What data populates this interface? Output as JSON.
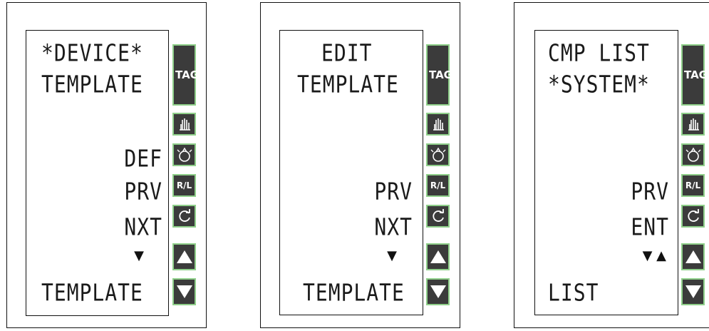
{
  "panels": [
    {
      "title_line1": "*DEVICE*",
      "title_line2": "TEMPLATE",
      "softkeys": [
        "DEF",
        "PRV",
        "NXT"
      ],
      "nav_arrows": "▼",
      "footer": "TEMPLATE"
    },
    {
      "title_line1": "EDIT",
      "title_line2": "TEMPLATE",
      "softkeys": [
        "PRV",
        "NXT"
      ],
      "nav_arrows": "▼",
      "footer": "TEMPLATE"
    },
    {
      "title_line1": "CMP LIST",
      "title_line2": "*SYSTEM*",
      "softkeys": [
        "PRV",
        "ENT"
      ],
      "nav_arrows": "▼ ▲",
      "footer": "LIST"
    }
  ],
  "keypad": {
    "tag_label": "TAG",
    "rl_label": "R/L",
    "key_icons": [
      "tag-key",
      "hand-icon",
      "actuator-icon",
      "rl-key",
      "refresh-icon",
      "up-arrow-icon",
      "down-arrow-icon"
    ]
  },
  "colors": {
    "key_fill": "#3b3b3b",
    "key_border": "#8fcf8a",
    "lcd_text": "#1a1a1a"
  }
}
